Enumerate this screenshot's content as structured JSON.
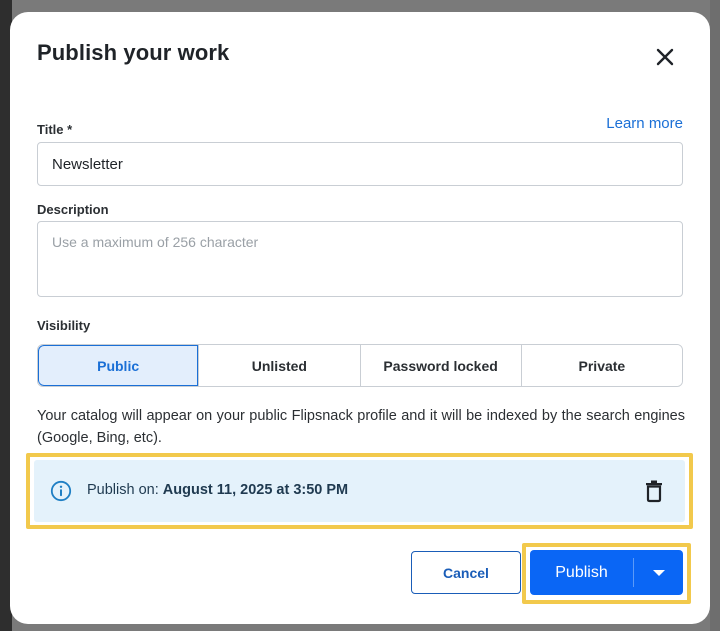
{
  "dialog": {
    "title": "Publish your work",
    "close_icon": "close-icon"
  },
  "form": {
    "learn_more": "Learn more",
    "title_label": "Title *",
    "title_value": "Newsletter",
    "description_label": "Description",
    "description_placeholder": "Use a maximum of 256 character",
    "visibility_label": "Visibility",
    "visibility_options": [
      {
        "label": "Public",
        "selected": true
      },
      {
        "label": "Unlisted",
        "selected": false
      },
      {
        "label": "Password locked",
        "selected": false
      },
      {
        "label": "Private",
        "selected": false
      }
    ],
    "visibility_help": "Your catalog will appear on your public Flipsnack profile and it will be indexed by the search engines (Google, Bing, etc)."
  },
  "schedule": {
    "prefix": "Publish on: ",
    "date": "August 11, 2025 at 3:50 PM",
    "info_icon": "info-icon",
    "delete_icon": "trash-icon",
    "background_color": "#e4f2fb"
  },
  "actions": {
    "cancel_label": "Cancel",
    "publish_label": "Publish",
    "dropdown_icon": "caret-down-icon",
    "publish_color": "#0a66f5"
  },
  "annotations": {
    "highlight_color": "#f2c94c"
  }
}
